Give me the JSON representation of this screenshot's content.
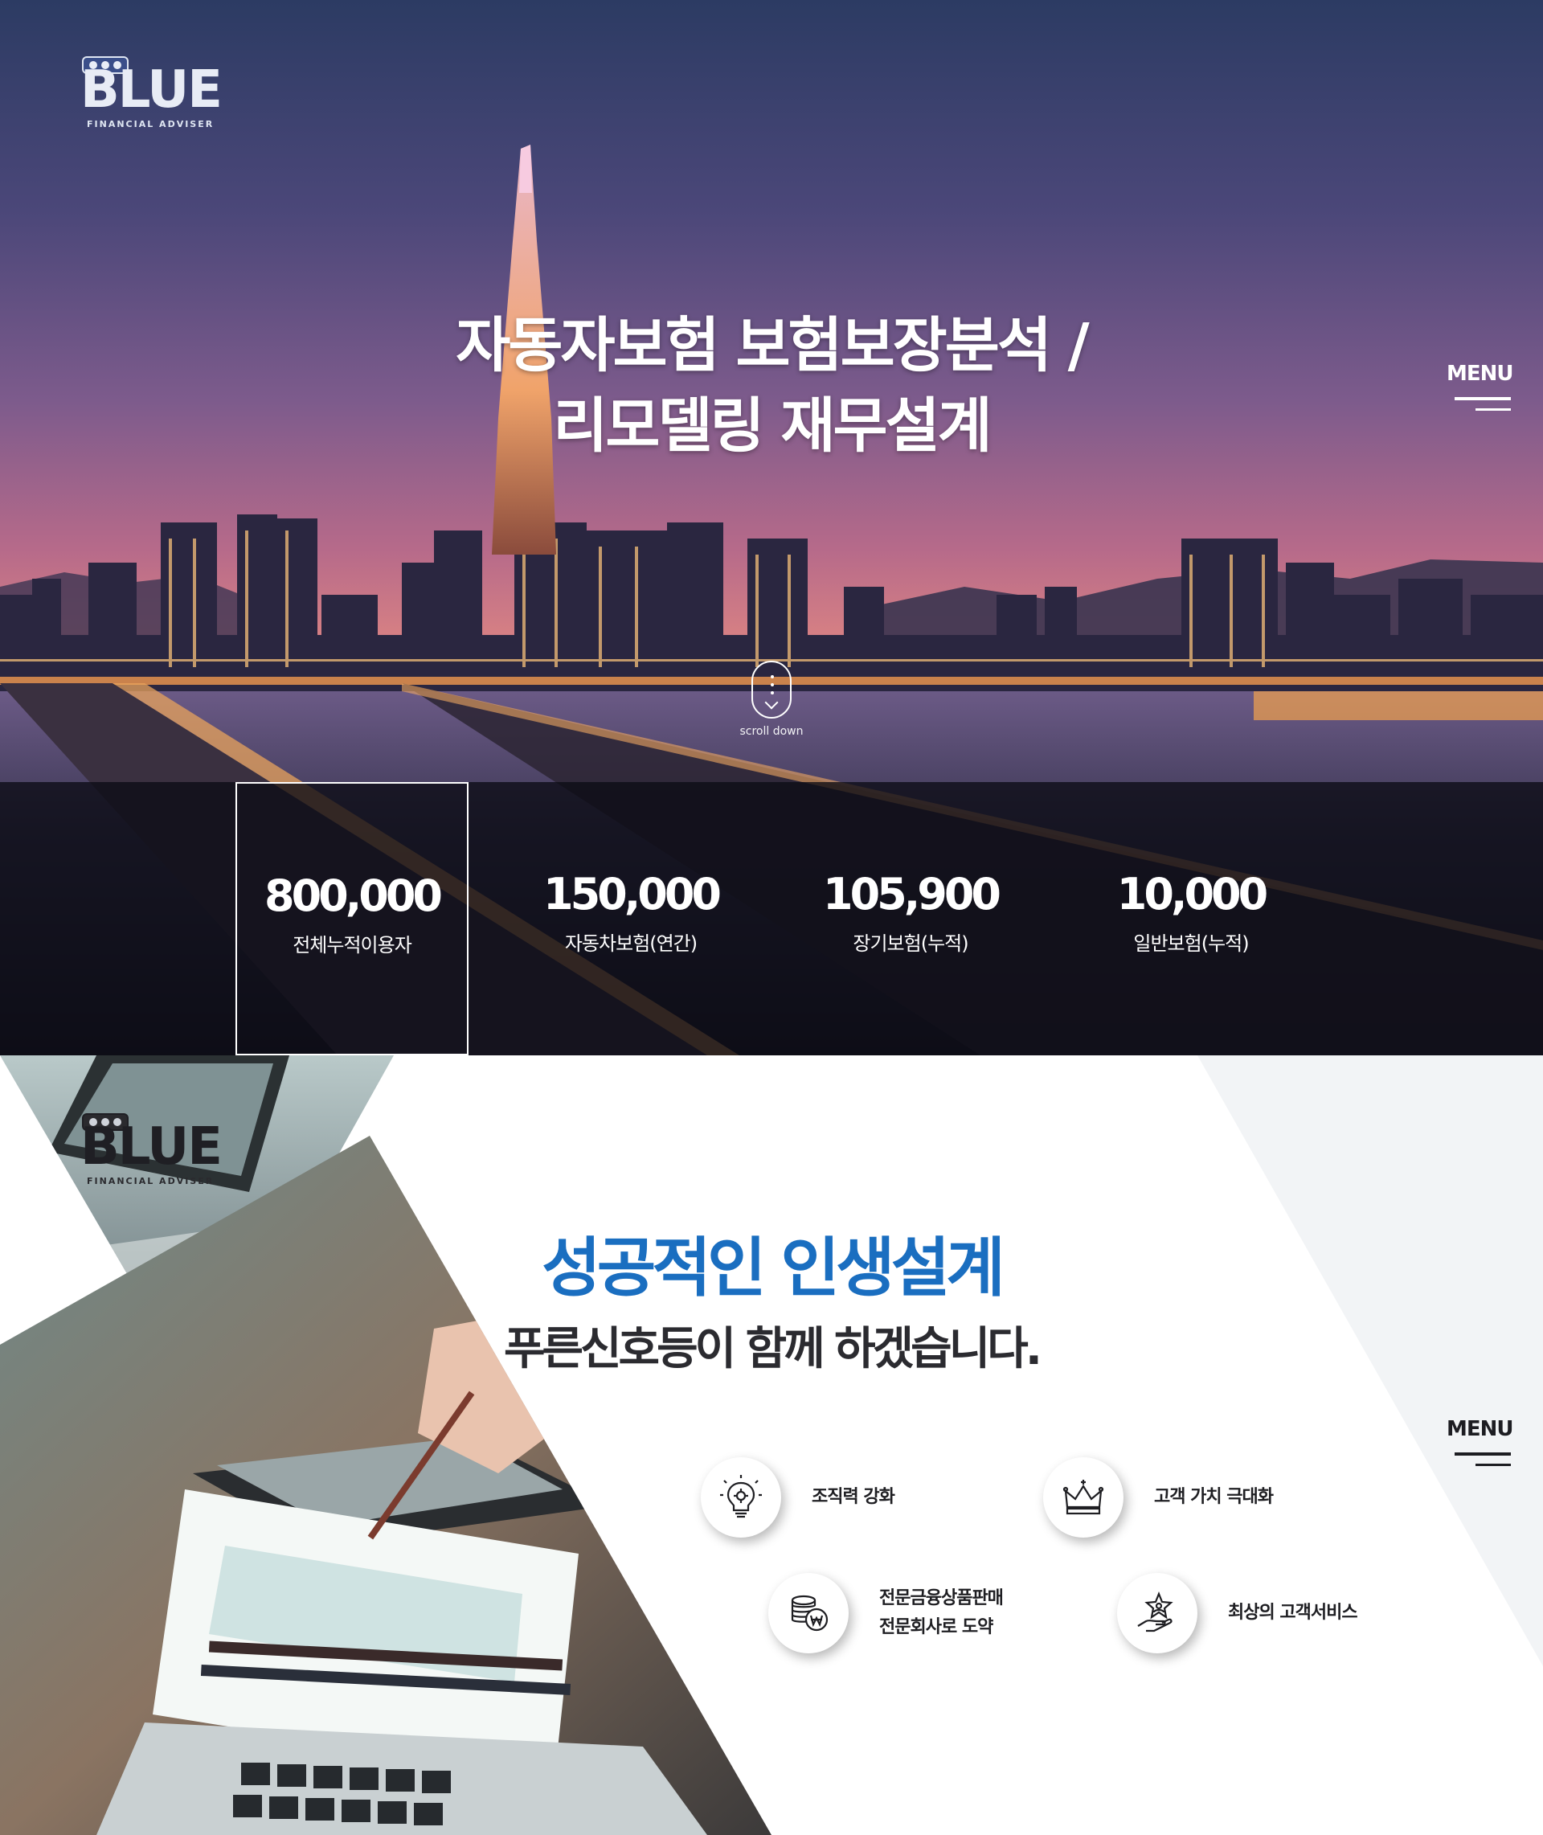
{
  "brand": {
    "logo_text": "BLUE",
    "logo_subtitle": "FINANCIAL ADVISER"
  },
  "hero": {
    "title_line1": "자동자보험 보험보장분석 /",
    "title_line2": "리모델링 재무설계",
    "menu_label": "MENU",
    "scroll_label": "scroll down"
  },
  "stats": [
    {
      "value": "800,000",
      "label": "전체누적이용자",
      "active": true
    },
    {
      "value": "150,000",
      "label": "자동차보험(연간)",
      "active": false
    },
    {
      "value": "105,900",
      "label": "장기보험(누적)",
      "active": false
    },
    {
      "value": "10,000",
      "label": "일반보험(누적)",
      "active": false
    }
  ],
  "section2": {
    "headline": "성공적인 인생설계",
    "subline": "푸른신호등이 함께 하겠습니다.",
    "menu_label": "MENU",
    "features": [
      {
        "icon": "lightbulb-gear-icon",
        "line1": "조직력 강화",
        "line2": ""
      },
      {
        "icon": "crown-icon",
        "line1": "고객 가치 극대화",
        "line2": ""
      },
      {
        "icon": "coins-won-icon",
        "line1": "전문금융상품판매",
        "line2": "전문회사로 도약"
      },
      {
        "icon": "hand-star-icon",
        "line1": "최상의 고객서비스",
        "line2": ""
      }
    ]
  },
  "colors": {
    "accent_blue": "#1a6ec0",
    "stats_overlay": "#0c0c14",
    "text_dark": "#2b2b30"
  }
}
